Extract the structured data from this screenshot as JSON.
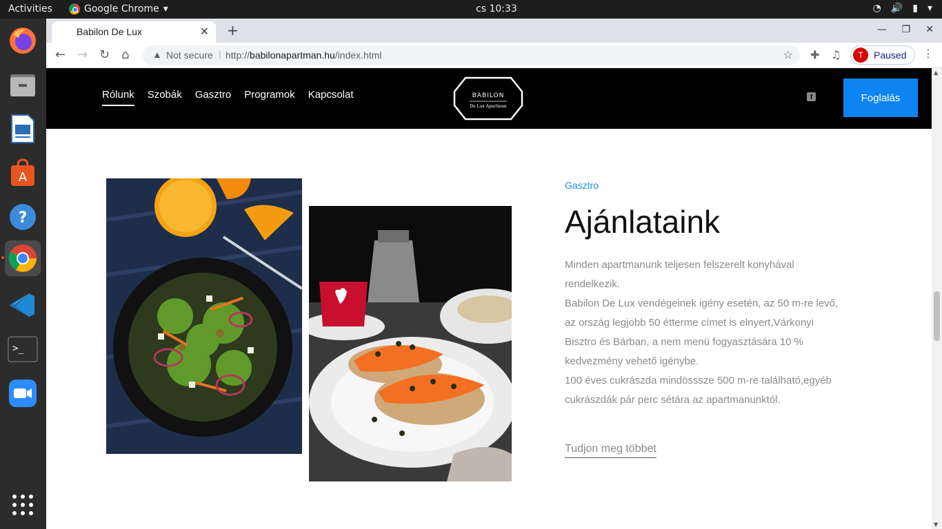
{
  "system": {
    "activities": "Activities",
    "app_name": "Google Chrome",
    "clock": "cs 10:33"
  },
  "dock": {
    "items": [
      "firefox-icon",
      "files-icon",
      "writer-icon",
      "software-icon",
      "help-icon",
      "chrome-icon",
      "vscode-icon",
      "terminal-icon",
      "zoom-icon",
      "apps-grid-icon"
    ]
  },
  "browser": {
    "tab_title": "Babilon De Lux",
    "security_label": "Not secure",
    "url_prefix": "http://",
    "url_domain": "babilonapartman.hu",
    "url_path": "/index.html",
    "profile_initial": "T",
    "profile_status": "Paused"
  },
  "site": {
    "nav": [
      "Rólunk",
      "Szobák",
      "Gasztro",
      "Programok",
      "Kapcsolat"
    ],
    "logo_line1": "BABILON",
    "logo_line2": "De Lux Apartman",
    "book_label": "Foglalás",
    "section_kicker": "Gasztro",
    "section_title": "Ajánlataink",
    "paragraph_lines": [
      "Minden apartmanunk teljesen felszerelt konyhával",
      "rendelkezik.",
      "Babilon De Lux vendégeinek igény esetén, az 50 m-re levő,",
      "az ország legjobb 50 étterme címet is elnyert,Várkonyi",
      "Bisztro és Bárban, a nem menü fogyasztására 10 %",
      "kedvezmény vehető igénybe.",
      "100 éves cukrászda mindösssze 500 m-re található,egyéb",
      "cukrászdák pár perc sétára az apartmanunktól."
    ],
    "more_link": "Tudjon meg többet"
  },
  "colors": {
    "accent": "#0d84f2",
    "nav_bg": "#000000",
    "text_muted": "#8a8a8a"
  }
}
